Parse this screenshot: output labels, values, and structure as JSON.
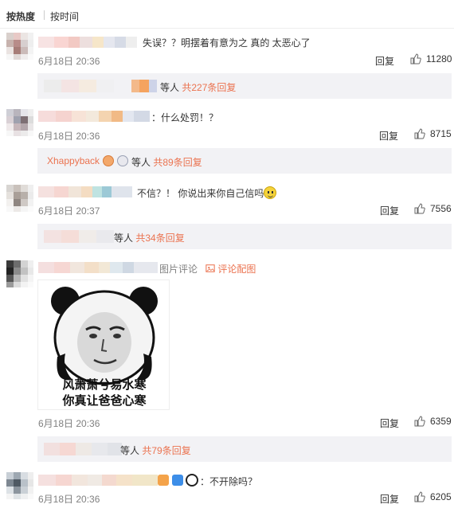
{
  "sort_tabs": {
    "hot": "按热度",
    "time": "按时间"
  },
  "reply_label": "回复",
  "comments": [
    {
      "text": "失误？？明摆着有意为之 真的 太恶心了",
      "date": "6月18日 20:36",
      "likes": "11280",
      "sub": {
        "prefix": "等人",
        "count": "共227条回复"
      }
    },
    {
      "text": "：什么处罚！？",
      "date": "6月18日 20:36",
      "likes": "8715",
      "sub": {
        "name": "Xhappyback",
        "prefix": "等人",
        "count": "共89条回复"
      }
    },
    {
      "text": "不信？！ 你说出来你自己信吗",
      "date": "6月18日 20:37",
      "likes": "7556",
      "sub": {
        "prefix": "等人",
        "count": "共34条回复"
      }
    },
    {
      "text": "图片评论",
      "image_link": "评论配图",
      "meme_caption_1": "风萧萧兮易水寒",
      "meme_caption_2": "你真让爸爸心寒",
      "date": "6月18日 20:36",
      "likes": "6359",
      "sub": {
        "prefix": "等人",
        "count": "共79条回复"
      }
    },
    {
      "text": "：不开除吗？",
      "date": "6月18日 20:36",
      "likes": "6205"
    }
  ],
  "colors": {
    "link": "#eb7350",
    "meta": "#808080",
    "subbox": "#f2f2f5"
  },
  "icons": {
    "like": "thumbs-up-icon",
    "image": "image-comment-icon",
    "emoji": "smiley-icon"
  }
}
